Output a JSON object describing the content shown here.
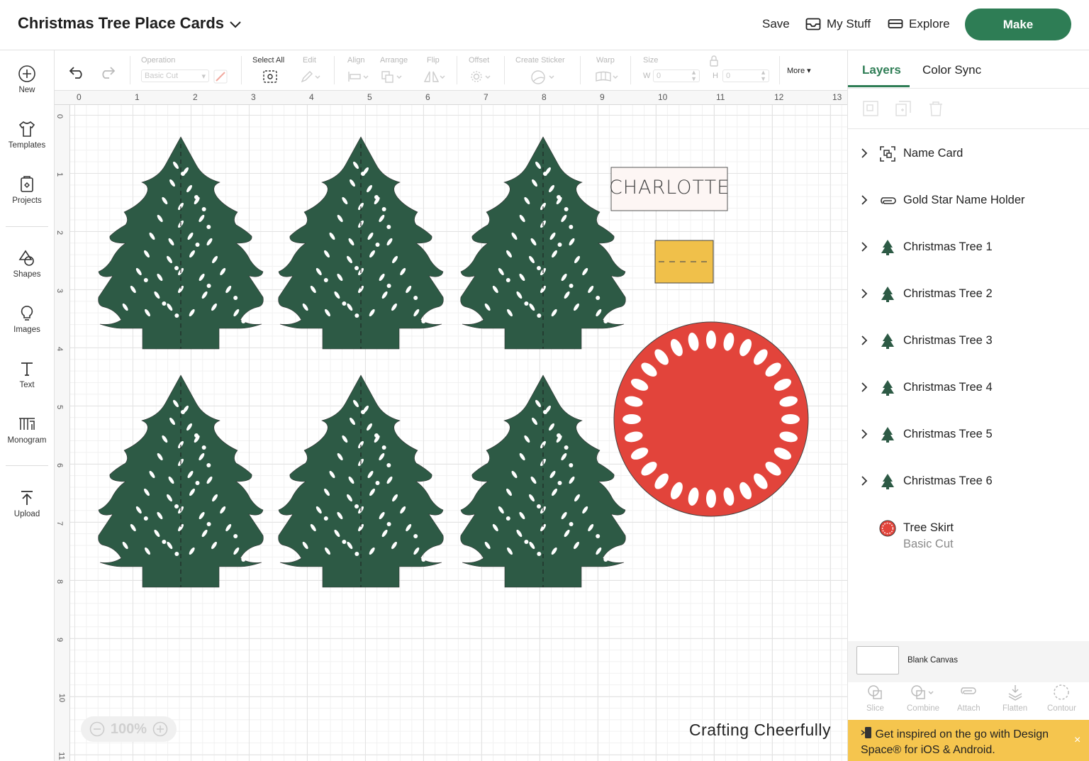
{
  "header": {
    "title": "Christmas Tree Place Cards",
    "save_label": "Save",
    "mystuff_label": "My Stuff",
    "explore_label": "Explore",
    "make_label": "Make"
  },
  "sidebar": {
    "items": [
      {
        "label": "New",
        "icon": "plus-circle-icon"
      },
      {
        "label": "Templates",
        "icon": "tshirt-icon"
      },
      {
        "label": "Projects",
        "icon": "projects-icon"
      },
      {
        "label": "Shapes",
        "icon": "shapes-icon"
      },
      {
        "label": "Images",
        "icon": "lightbulb-icon"
      },
      {
        "label": "Text",
        "icon": "text-icon"
      },
      {
        "label": "Monogram",
        "icon": "monogram-icon"
      },
      {
        "label": "Upload",
        "icon": "upload-icon"
      }
    ]
  },
  "toolbar": {
    "operation_label": "Operation",
    "operation_value": "Basic Cut",
    "select_all_label": "Select All",
    "edit_label": "Edit",
    "align_label": "Align",
    "arrange_label": "Arrange",
    "flip_label": "Flip",
    "offset_label": "Offset",
    "create_sticker_label": "Create Sticker",
    "warp_label": "Warp",
    "size_label": "Size",
    "w_label": "W",
    "w_value": "0",
    "h_label": "H",
    "h_value": "0",
    "more_label": "More"
  },
  "canvas": {
    "ruler_top": [
      "0",
      "1",
      "2",
      "3",
      "4",
      "5",
      "6",
      "7",
      "8",
      "9",
      "10",
      "11",
      "12",
      "13"
    ],
    "ruler_left": [
      "0",
      "1",
      "2",
      "3",
      "4",
      "5",
      "6",
      "7",
      "8",
      "9",
      "10",
      "11"
    ],
    "name_card_text": "CHARLOTTE",
    "zoom_value": "100%",
    "watermark": "Crafting Cheerfully",
    "colors": {
      "tree": "#2d5a45",
      "skirt": "#e2443b",
      "holder": "#f0c04a",
      "card": "#fdf6f4"
    }
  },
  "panel": {
    "tab_layers": "Layers",
    "tab_colorsync": "Color Sync",
    "layers": [
      {
        "name": "Name Card",
        "icon": "group-icon"
      },
      {
        "name": "Gold Star Name Holder",
        "icon": "attach-icon"
      },
      {
        "name": "Christmas Tree 1",
        "icon": "tree-thumb-icon"
      },
      {
        "name": "Christmas Tree 2",
        "icon": "tree-thumb-icon"
      },
      {
        "name": "Christmas Tree 3",
        "icon": "tree-thumb-icon"
      },
      {
        "name": "Christmas Tree 4",
        "icon": "tree-thumb-icon"
      },
      {
        "name": "Christmas Tree 5",
        "icon": "tree-thumb-icon"
      },
      {
        "name": "Christmas Tree 6",
        "icon": "tree-thumb-icon"
      },
      {
        "name": "Tree Skirt",
        "sub": "Basic Cut",
        "icon": "skirt-thumb-icon"
      }
    ],
    "blank_canvas_label": "Blank Canvas",
    "bottom_tools": [
      "Slice",
      "Combine",
      "Attach",
      "Flatten",
      "Contour"
    ],
    "banner_text": "Get inspired on the go with Design Space® for iOS & Android.",
    "banner_close": "×"
  }
}
